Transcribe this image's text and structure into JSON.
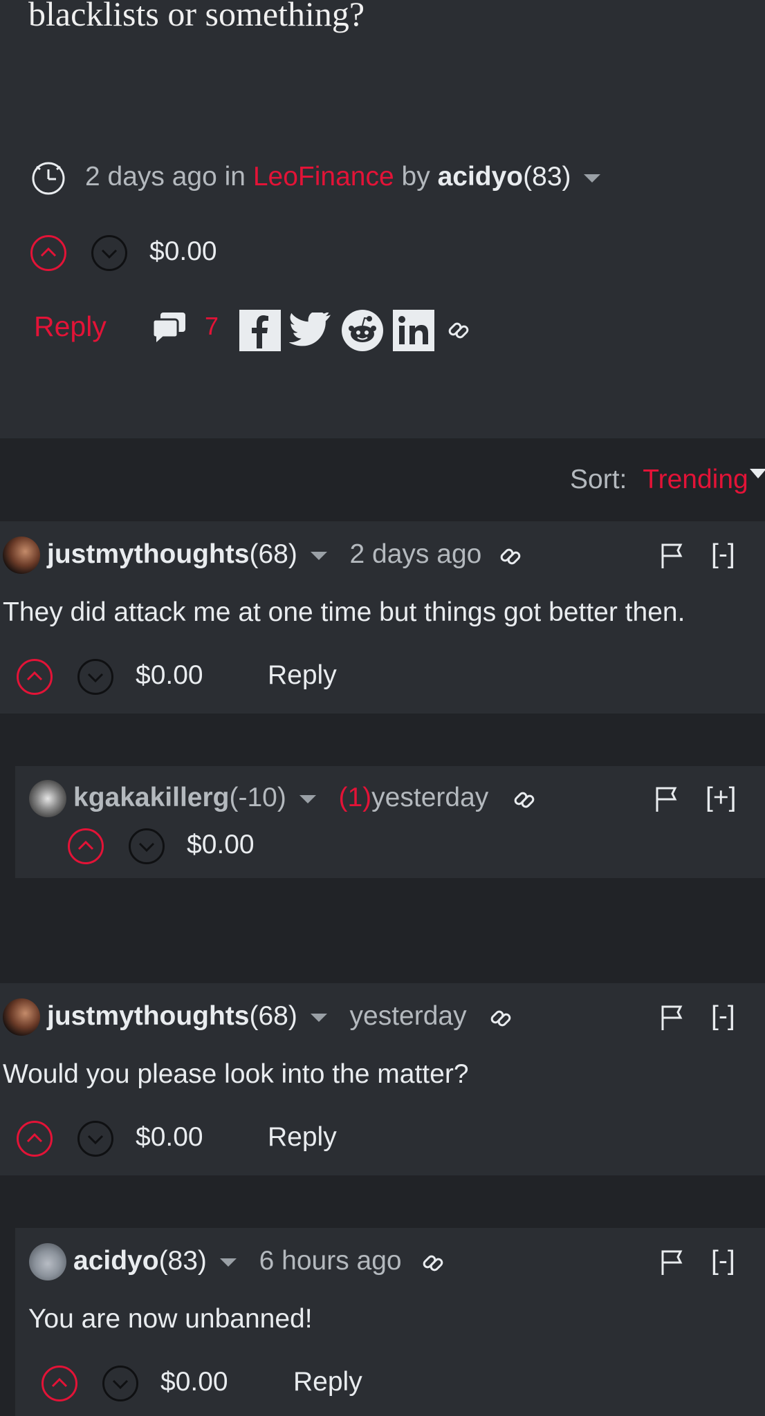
{
  "post": {
    "title_tail": "blacklists or something?",
    "meta": {
      "time": "2 days ago in",
      "community": "LeoFinance",
      "by": "by",
      "author": "acidyo",
      "reputation": "(83)"
    },
    "payout": "$0.00",
    "reply_label": "Reply",
    "comment_count": "7"
  },
  "sort": {
    "label": "Sort:",
    "value": "Trending"
  },
  "comments": [
    {
      "author": "justmythoughts",
      "reputation": "(68)",
      "time": "2 days ago",
      "toggle": "[-]",
      "body": "They did attack me at one time but things got better then.",
      "payout": "$0.00",
      "reply_label": "Reply"
    },
    {
      "author": "kgakakillerg",
      "reputation": "(-10)",
      "flag_count": "(1)",
      "time": "yesterday",
      "toggle": "[+]",
      "payout": "$0.00"
    },
    {
      "author": "justmythoughts",
      "reputation": "(68)",
      "time": "yesterday",
      "toggle": "[-]",
      "body": "Would you please look into the matter?",
      "payout": "$0.00",
      "reply_label": "Reply"
    },
    {
      "author": "acidyo",
      "reputation": "(83)",
      "time": "6 hours ago",
      "toggle": "[-]",
      "body": "You are now unbanned!",
      "payout": "$0.00",
      "reply_label": "Reply"
    }
  ],
  "colors": {
    "accent": "#e31337",
    "background": "#2b2e33",
    "section_dark": "#212327"
  },
  "icons": [
    "clock-icon",
    "upvote-icon",
    "downvote-icon",
    "comments-icon",
    "facebook-icon",
    "twitter-icon",
    "reddit-icon",
    "linkedin-icon",
    "link-icon",
    "flag-icon",
    "dropdown-caret-icon",
    "sort-caret-icon"
  ]
}
